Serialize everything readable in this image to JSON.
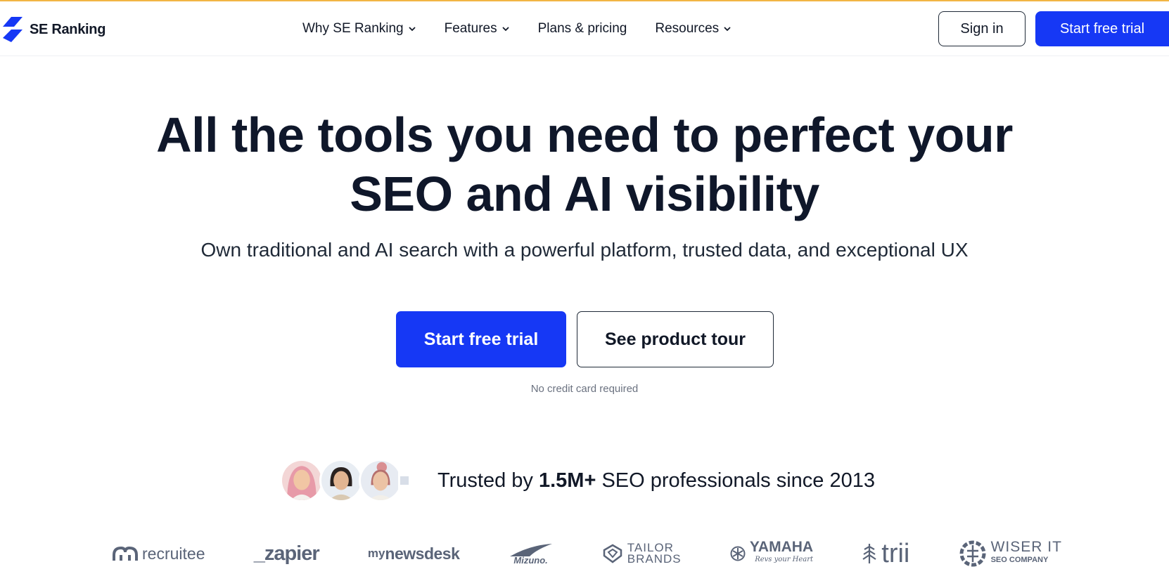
{
  "header": {
    "logo_text": "SE Ranking",
    "nav": [
      {
        "label": "Why SE Ranking",
        "has_dropdown": true
      },
      {
        "label": "Features",
        "has_dropdown": true
      },
      {
        "label": "Plans & pricing",
        "has_dropdown": false
      },
      {
        "label": "Resources",
        "has_dropdown": true
      }
    ],
    "sign_in_label": "Sign in",
    "trial_label": "Start free trial"
  },
  "hero": {
    "title_line1": "All the tools you need to perfect your",
    "title_line2": "SEO and AI visibility",
    "subtitle": "Own traditional and AI search with a powerful platform, trusted data, and exceptional UX",
    "primary_cta": "Start free trial",
    "secondary_cta": "See product tour",
    "note": "No credit card required"
  },
  "trust": {
    "prefix": "Trusted by ",
    "highlight": "1.5M+",
    "suffix": " SEO professionals since 2013"
  },
  "brands": {
    "recruitee": "recruitee",
    "zapier": "_zapier",
    "mynewsdesk_my": "my",
    "mynewsdesk_rest": "newsdesk",
    "mizuno": "Mizuno.",
    "tailor_top": "TAILOR",
    "tailor_bottom": "BRANDS",
    "yamaha": "YAMAHA",
    "yamaha_tag": "Revs your Heart",
    "trii": "trii",
    "wiser_top": "WISER IT",
    "wiser_bottom": "SEO COMPANY"
  },
  "colors": {
    "accent": "#1638f5",
    "top_bar": "#f2b544",
    "brand_gray": "#5a6478"
  }
}
